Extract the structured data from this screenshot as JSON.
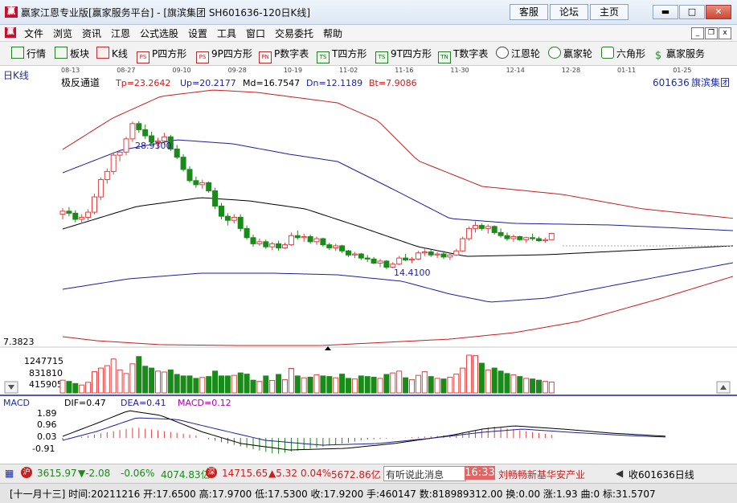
{
  "window": {
    "title": "赢家江恩专业版[赢家服务平台] - [旗滨集团  SH601636-120日K线]",
    "links": [
      "客服",
      "论坛",
      "主页"
    ],
    "controls": [
      "▬",
      "□",
      "✕"
    ]
  },
  "menu": {
    "items": [
      "文件",
      "浏览",
      "资讯",
      "江恩",
      "公式选股",
      "设置",
      "工具",
      "窗口",
      "交易委托",
      "帮助"
    ],
    "mdi_controls": [
      "_",
      "❐",
      "x"
    ]
  },
  "toolbar": {
    "items": [
      {
        "label": "行情",
        "icon": "grid-icon"
      },
      {
        "label": "板块",
        "icon": "blocks-icon"
      },
      {
        "label": "K线",
        "icon": "candlestick-icon"
      },
      {
        "label": "P四方形",
        "icon": "ps-icon"
      },
      {
        "label": "9P四方形",
        "icon": "ps-icon"
      },
      {
        "label": "P数字表",
        "icon": "pn-icon"
      },
      {
        "label": "T四方形",
        "icon": "ts-icon"
      },
      {
        "label": "9T四方形",
        "icon": "ts-icon"
      },
      {
        "label": "T数字表",
        "icon": "tn-icon"
      },
      {
        "label": "江恩轮",
        "icon": "wheel-icon"
      },
      {
        "label": "赢家轮",
        "icon": "wheel-icon"
      },
      {
        "label": "六角形",
        "icon": "hexagon-icon"
      },
      {
        "label": "赢家服务",
        "icon": "dollar-icon"
      }
    ]
  },
  "chart": {
    "period_label": "日K线",
    "date_ticks": [
      "08-13",
      "08-27",
      "09-10",
      "09-28",
      "10-19",
      "11-02",
      "11-16",
      "11-30",
      "12-14",
      "12-28",
      "01-11",
      "01-25"
    ],
    "indicator_name": "极反通道",
    "tp": "Tp=23.2642",
    "up": "Up=20.2177",
    "md": "Md=16.7547",
    "dn": "Dn=12.1189",
    "bt": "Bt=7.9086",
    "stock_code": "601636",
    "stock_name": "旗滨集团",
    "high_label": "28.9300",
    "low_label": "14.4100",
    "price_axis_label": "7.3823",
    "volume_labels": [
      "1247715",
      "831810",
      "415905"
    ],
    "macd_title": "MACD",
    "dif": "DIF=0.47",
    "dea": "DEA=0.41",
    "macd": "MACD=0.12",
    "macd_axis": [
      "1.89",
      "0.96",
      "0.03",
      "-0.91"
    ],
    "colors": {
      "up": "#e04040",
      "down": "#1a8a1a",
      "band_outer": "#c81e1e",
      "band_inner": "#1e1e9c",
      "mid": "#000000"
    }
  },
  "chart_data": {
    "type": "candlestick",
    "title": "旗滨集团 SH601636-120日K线",
    "ylim": [
      7.3823,
      32
    ],
    "high_marker": 28.93,
    "low_marker": 14.41,
    "ohlc": [
      [
        19.8,
        20.4,
        19.3,
        20.1
      ],
      [
        20.1,
        20.5,
        19.6,
        19.9
      ],
      [
        19.9,
        20.2,
        19.0,
        19.3
      ],
      [
        19.3,
        19.8,
        18.9,
        19.5
      ],
      [
        19.5,
        20.3,
        19.2,
        20.0
      ],
      [
        20.0,
        21.8,
        19.8,
        21.5
      ],
      [
        21.5,
        23.4,
        21.2,
        23.2
      ],
      [
        23.2,
        24.3,
        22.8,
        24.0
      ],
      [
        24.0,
        25.9,
        23.7,
        25.6
      ],
      [
        25.6,
        26.1,
        25.0,
        25.9
      ],
      [
        25.9,
        27.4,
        25.6,
        27.2
      ],
      [
        27.2,
        28.9,
        26.9,
        28.7
      ],
      [
        28.7,
        28.93,
        27.8,
        28.1
      ],
      [
        28.1,
        28.6,
        27.2,
        27.5
      ],
      [
        27.5,
        27.9,
        26.6,
        26.9
      ],
      [
        26.9,
        27.3,
        26.2,
        27.0
      ],
      [
        27.0,
        27.8,
        26.6,
        27.4
      ],
      [
        27.4,
        27.6,
        26.0,
        26.2
      ],
      [
        26.2,
        26.6,
        25.2,
        25.4
      ],
      [
        25.4,
        25.7,
        24.0,
        24.2
      ],
      [
        24.2,
        24.5,
        22.9,
        23.1
      ],
      [
        23.1,
        23.5,
        22.4,
        22.7
      ],
      [
        22.7,
        23.2,
        22.3,
        22.9
      ],
      [
        22.9,
        23.0,
        21.9,
        22.1
      ],
      [
        22.1,
        22.4,
        20.3,
        20.6
      ],
      [
        20.6,
        20.9,
        19.3,
        19.6
      ],
      [
        19.6,
        19.9,
        18.7,
        19.2
      ],
      [
        19.2,
        19.8,
        18.9,
        19.5
      ],
      [
        19.5,
        19.8,
        18.1,
        18.4
      ],
      [
        18.4,
        18.7,
        17.3,
        17.5
      ],
      [
        17.5,
        17.8,
        16.6,
        16.9
      ],
      [
        16.9,
        17.4,
        16.7,
        17.1
      ],
      [
        17.1,
        17.3,
        16.4,
        16.6
      ],
      [
        16.6,
        17.1,
        16.3,
        16.9
      ],
      [
        16.9,
        17.2,
        16.2,
        16.5
      ],
      [
        16.5,
        17.0,
        16.4,
        16.8
      ],
      [
        16.8,
        18.0,
        16.7,
        17.7
      ],
      [
        17.7,
        18.2,
        17.3,
        17.5
      ],
      [
        17.5,
        17.9,
        17.1,
        17.6
      ],
      [
        17.6,
        17.8,
        16.9,
        17.1
      ],
      [
        17.1,
        17.6,
        16.8,
        17.4
      ],
      [
        17.4,
        17.5,
        16.6,
        16.8
      ],
      [
        16.8,
        17.0,
        16.3,
        16.5
      ],
      [
        16.5,
        16.9,
        16.2,
        16.7
      ],
      [
        16.7,
        16.8,
        16.0,
        16.2
      ],
      [
        16.2,
        16.3,
        15.6,
        15.8
      ],
      [
        15.8,
        16.1,
        15.5,
        15.9
      ],
      [
        15.9,
        16.0,
        15.3,
        15.5
      ],
      [
        15.5,
        15.8,
        15.1,
        15.4
      ],
      [
        15.4,
        15.6,
        14.9,
        15.0
      ],
      [
        15.0,
        15.4,
        14.6,
        15.2
      ],
      [
        15.2,
        15.3,
        14.41,
        14.6
      ],
      [
        14.6,
        15.1,
        14.5,
        14.9
      ],
      [
        14.9,
        15.7,
        14.8,
        15.5
      ],
      [
        15.5,
        15.9,
        15.2,
        15.3
      ],
      [
        15.3,
        15.6,
        15.0,
        15.4
      ],
      [
        15.4,
        16.2,
        15.3,
        16.0
      ],
      [
        16.0,
        16.4,
        15.7,
        16.1
      ],
      [
        16.1,
        16.3,
        15.6,
        15.8
      ],
      [
        15.8,
        16.1,
        15.5,
        15.9
      ],
      [
        15.9,
        16.2,
        15.4,
        15.6
      ],
      [
        15.6,
        16.0,
        15.3,
        15.8
      ],
      [
        15.8,
        16.4,
        15.7,
        16.2
      ],
      [
        16.2,
        17.6,
        16.1,
        17.4
      ],
      [
        17.4,
        18.6,
        17.2,
        18.4
      ],
      [
        18.4,
        19.1,
        18.0,
        18.7
      ],
      [
        18.7,
        18.9,
        18.2,
        18.4
      ],
      [
        18.4,
        18.8,
        17.9,
        18.6
      ],
      [
        18.6,
        18.7,
        17.8,
        18.0
      ],
      [
        18.0,
        18.4,
        17.5,
        17.7
      ],
      [
        17.7,
        18.0,
        17.2,
        17.4
      ],
      [
        17.4,
        17.8,
        17.1,
        17.6
      ],
      [
        17.6,
        17.7,
        17.2,
        17.3
      ],
      [
        17.3,
        17.6,
        17.0,
        17.5
      ],
      [
        17.5,
        17.9,
        17.2,
        17.4
      ],
      [
        17.4,
        17.6,
        17.1,
        17.2
      ],
      [
        17.2,
        17.5,
        17.0,
        17.3
      ],
      [
        17.3,
        17.97,
        17.25,
        17.92
      ]
    ],
    "volumes": [
      420,
      380,
      310,
      260,
      350,
      700,
      820,
      900,
      1120,
      760,
      640,
      960,
      1200,
      880,
      820,
      720,
      690,
      760,
      610,
      560,
      560,
      480,
      510,
      540,
      720,
      560,
      560,
      580,
      660,
      620,
      420,
      380,
      560,
      410,
      610,
      440,
      810,
      560,
      500,
      520,
      600,
      560,
      540,
      500,
      620,
      480,
      460,
      560,
      540,
      520,
      480,
      610,
      660,
      720,
      500,
      440,
      580,
      700,
      540,
      480,
      460,
      520,
      620,
      820,
      1247,
      1230,
      980,
      760,
      820,
      720,
      640,
      600,
      540,
      480,
      460,
      420,
      380,
      360
    ]
  },
  "status": {
    "sh_index": "3615.97",
    "sh_change": "▼-2.08",
    "sh_pct": "-0.06%",
    "sh_amount": "4074.83亿",
    "sz_index": "14715.65",
    "sz_change": "▲5.32",
    "sz_pct": "0.04%",
    "sz_amount": "5672.86亿",
    "news_text": "有听说此消息",
    "news_time": "16:33",
    "news_headline": "刘畅畅新基华安产业",
    "collect_label": "收601636日线",
    "bar_info": "[十一月十三] 时间:20211216 开:17.6500 高:17.9700 低:17.5300 收:17.9200 手:460147 数:818989312.00 换:0.00 涨:1.93 曲:0 标:31.5707"
  }
}
